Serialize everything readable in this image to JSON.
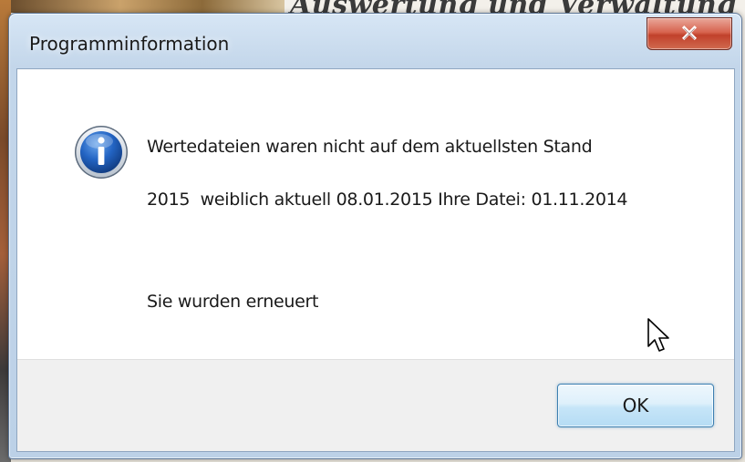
{
  "window": {
    "title": "Programminformation",
    "close_glyph": "x"
  },
  "message": {
    "icon": "info-icon",
    "line1": "Wertedateien waren nicht auf dem aktuellsten Stand",
    "line2": "2015  weiblich aktuell 08.01.2015 Ihre Datei: 01.11.2014",
    "line3": "Sie wurden erneuert"
  },
  "buttons": {
    "ok_label": "OK"
  },
  "background": {
    "heading_fragment": "Auswertung und Verwaltung"
  },
  "colors": {
    "close_button": "#c1412b",
    "ok_border": "#3c7fb1",
    "icon_blue": "#1b5fb9"
  }
}
